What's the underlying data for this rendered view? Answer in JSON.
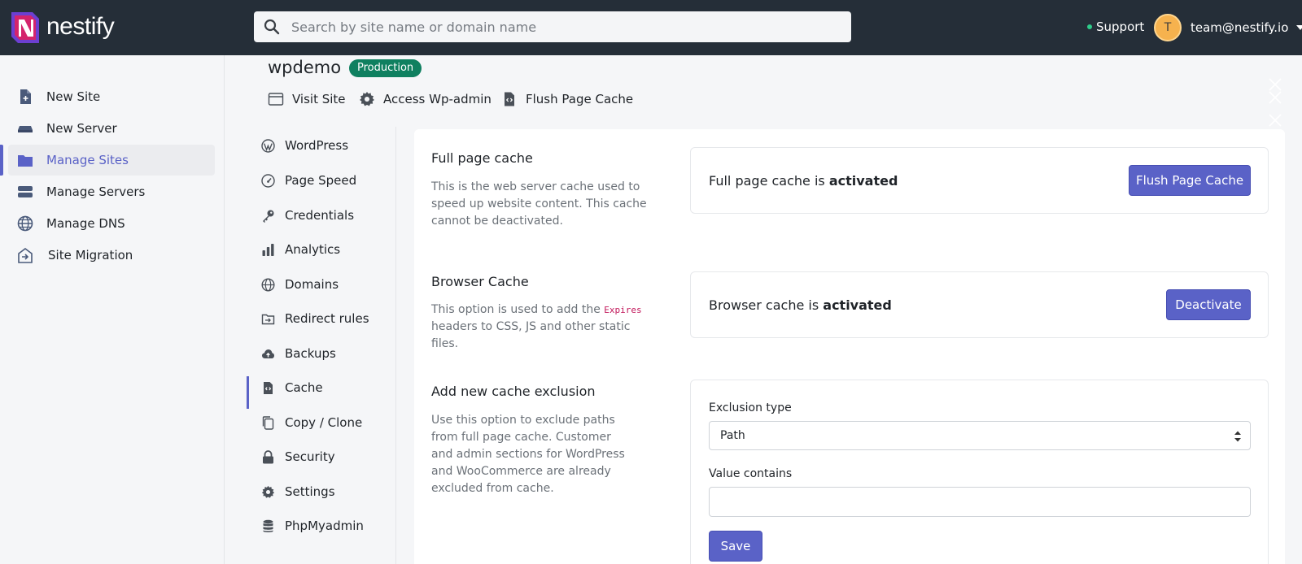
{
  "app": {
    "logo_text": "nestify",
    "search_placeholder": "Search by site name or domain name",
    "support_label": "Support",
    "account_initial": "T",
    "account_email": "team@nestify.io"
  },
  "sidebar": {
    "items": [
      {
        "label": "New Site",
        "icon": "new-site-icon"
      },
      {
        "label": "New Server",
        "icon": "server-icon"
      },
      {
        "label": "Manage Sites",
        "icon": "folder-icon",
        "active": true
      },
      {
        "label": "Manage Servers",
        "icon": "servers-icon"
      },
      {
        "label": "Manage DNS",
        "icon": "globe-icon"
      },
      {
        "label": "Site Migration",
        "icon": "migration-icon"
      }
    ]
  },
  "site": {
    "name": "wpdemo",
    "badge": "Production",
    "actions": [
      {
        "label": "Visit Site",
        "icon": "browser-window-icon"
      },
      {
        "label": "Access Wp-admin",
        "icon": "gear-icon"
      },
      {
        "label": "Flush Page Cache",
        "icon": "file-code-icon"
      }
    ]
  },
  "submenu": {
    "items": [
      {
        "label": "WordPress",
        "icon": "wordpress-icon"
      },
      {
        "label": "Page Speed",
        "icon": "speedometer-icon"
      },
      {
        "label": "Credentials",
        "icon": "key-icon"
      },
      {
        "label": "Analytics",
        "icon": "bar-chart-icon"
      },
      {
        "label": "Domains",
        "icon": "globe-icon"
      },
      {
        "label": "Redirect rules",
        "icon": "redirect-icon"
      },
      {
        "label": "Backups",
        "icon": "cloud-upload-icon"
      },
      {
        "label": "Cache",
        "icon": "file-code-icon",
        "active": true
      },
      {
        "label": "Copy / Clone",
        "icon": "copy-icon"
      },
      {
        "label": "Security",
        "icon": "lock-icon"
      },
      {
        "label": "Settings",
        "icon": "gear-icon"
      },
      {
        "label": "PhpMyadmin",
        "icon": "database-icon"
      }
    ]
  },
  "sections": {
    "full_page_cache": {
      "title": "Full page cache",
      "description": "This is the web server cache used to speed up website content. This cache cannot be deactivated.",
      "status_prefix": "Full page cache is ",
      "status_value": "activated",
      "button": "Flush Page Cache"
    },
    "browser_cache": {
      "title": "Browser Cache",
      "description_before": "This option is used to add the ",
      "description_code": "Expires",
      "description_after": " headers to CSS, JS and other static files.",
      "status_prefix": "Browser cache is ",
      "status_value": "activated",
      "button": "Deactivate"
    },
    "cache_exclusion": {
      "title": "Add new cache exclusion",
      "description": "Use this option to exclude paths from full page cache. Customer and admin sections for WordPress and WooCommerce are already excluded from cache.",
      "exclusion_type_label": "Exclusion type",
      "exclusion_type_value": "Path",
      "value_contains_label": "Value contains",
      "value_contains_value": "",
      "save_button": "Save"
    }
  },
  "colors": {
    "topbar": "#252e38",
    "accent": "#5a62c7",
    "badge": "#0f8060",
    "avatar": "#f6b24e"
  }
}
